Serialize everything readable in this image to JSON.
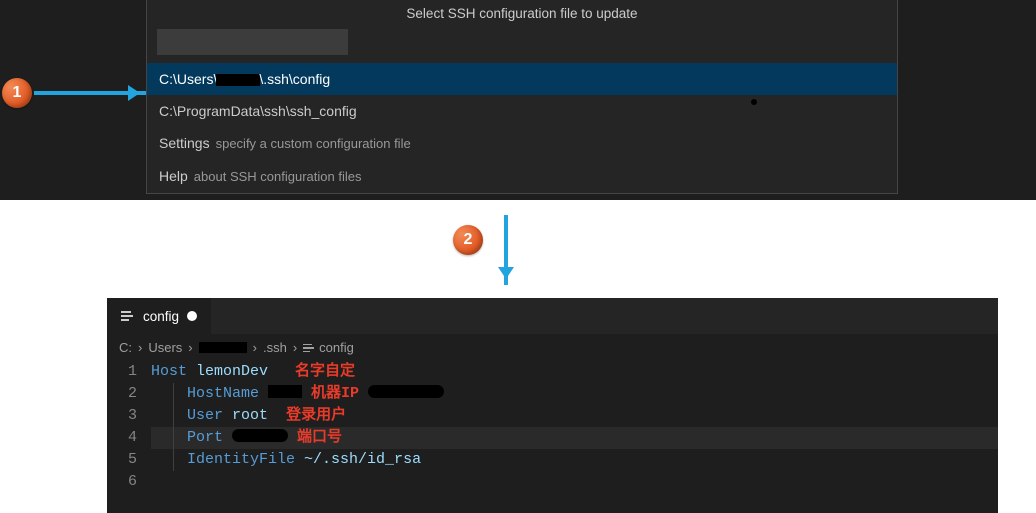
{
  "step1": "1",
  "step2": "2",
  "quickpick": {
    "title": "Select SSH configuration file to update",
    "input_value": "",
    "items": [
      {
        "prefix": "C:\\Users\\",
        "suffix": "\\.ssh\\config",
        "detail": ""
      },
      {
        "primary": "C:\\ProgramData\\ssh\\ssh_config",
        "detail": ""
      },
      {
        "primary": "Settings",
        "detail": "specify a custom configuration file"
      },
      {
        "primary": "Help",
        "detail": "about SSH configuration files"
      }
    ]
  },
  "editor": {
    "tab": {
      "name": "config"
    },
    "breadcrumb": {
      "c": "C:",
      "users": "Users",
      "ssh": ".ssh",
      "file": "config"
    },
    "lines": {
      "n1": "1",
      "n2": "2",
      "n3": "3",
      "n4": "4",
      "n5": "5",
      "n6": "6",
      "host_kw": "Host ",
      "host_val": "lemonDev",
      "host_note": "名字自定",
      "hostname_kw": "HostName ",
      "hostname_note": "机器IP",
      "user_kw": "User ",
      "user_val": "root",
      "user_note": "登录用户",
      "port_kw": "Port ",
      "port_note": "端口号",
      "idfile_kw": "IdentityFile ",
      "idfile_val": "~/.ssh/id_rsa"
    }
  }
}
